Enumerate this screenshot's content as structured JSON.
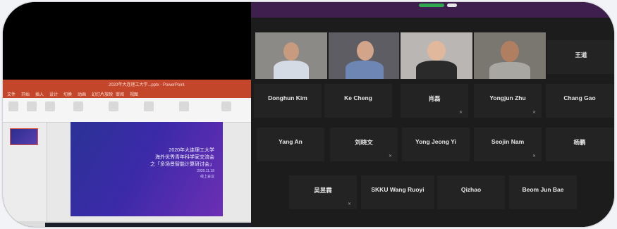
{
  "presentation": {
    "window_title": "2020年大连理工大学...pptx - PowerPoint",
    "ribbon_tabs": [
      "文件",
      "开始",
      "插入",
      "设计",
      "切换",
      "动画",
      "幻灯片放映",
      "审阅",
      "视图"
    ],
    "slide_lines": [
      "2020年大连理工大学",
      "海外优秀青年科学家交流会",
      "之「多场景智能计算研讨会」"
    ],
    "slide_subtitle_1": "2020.11.18",
    "slide_subtitle_2": "线上会议"
  },
  "gallery": {
    "video_participants": [
      {
        "name": "participant-1",
        "bg": "#8c8a86",
        "shirt": "#d5dbe4"
      },
      {
        "name": "participant-2",
        "bg": "#5e5d63",
        "shirt": "#6d86b3"
      },
      {
        "name": "participant-3",
        "bg": "#b9b6b4",
        "shirt": "#2a2a2a"
      },
      {
        "name": "participant-4",
        "bg": "#7a7670",
        "shirt": "#a8a7a2"
      }
    ],
    "row1_extra": "王道",
    "row2": [
      "Donghun Kim",
      "Ke Cheng",
      "肖磊",
      "Yongjun Zhu",
      "Chang Gao"
    ],
    "row3": [
      "Yang An",
      "刘晓文",
      "Yong Jeong Yi",
      "Seojin Nam",
      "杨鹏"
    ],
    "row4": [
      "吴昱霖",
      "SKKU Wang Ruoyi",
      "Qizhao",
      "Beom Jun Bae"
    ]
  },
  "colors": {
    "ppt_accent": "#c4462a",
    "gallery_bg": "#1c1c1c",
    "tile_bg": "#232323",
    "top_strip": "#3f1f4e"
  }
}
